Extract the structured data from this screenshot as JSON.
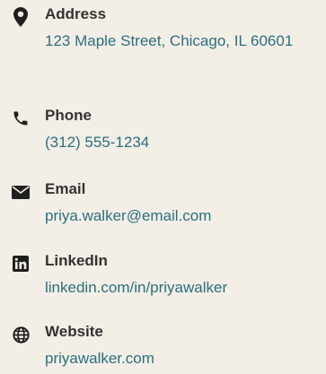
{
  "contact": {
    "items": [
      {
        "icon": "map-marker-icon",
        "label": "Address",
        "value": "123 Maple Street, Chicago, IL 60601"
      },
      {
        "icon": "phone-icon",
        "label": "Phone",
        "value": "(312) 555-1234"
      },
      {
        "icon": "envelope-icon",
        "label": "Email",
        "value": "priya.walker@email.com"
      },
      {
        "icon": "linkedin-icon",
        "label": "LinkedIn",
        "value": "linkedin.com/in/priyawalker"
      },
      {
        "icon": "globe-icon",
        "label": "Website",
        "value": "priyawalker.com"
      }
    ]
  },
  "colors": {
    "background": "#f3efe6",
    "label": "#333333",
    "value": "#2b6f80",
    "icon": "#1f1f1f"
  }
}
